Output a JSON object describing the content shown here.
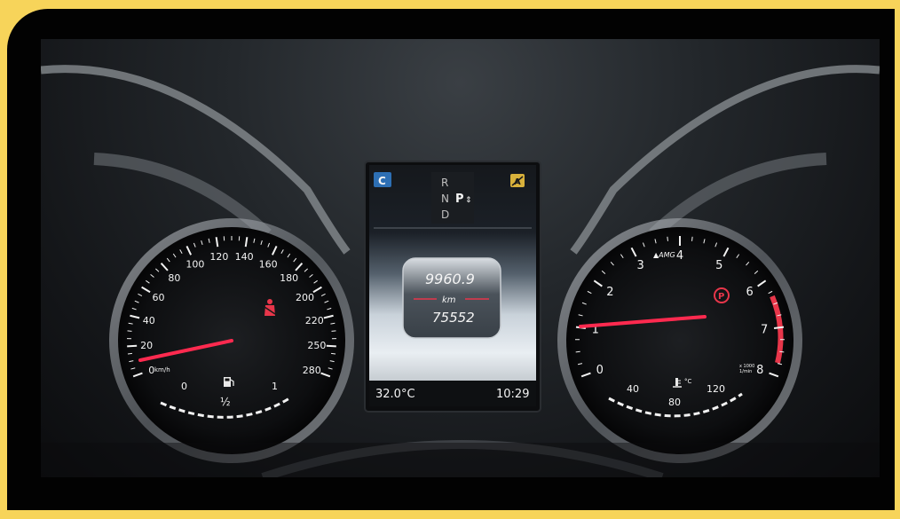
{
  "speedometer": {
    "ticks": [
      "0",
      "20",
      "40",
      "60",
      "80",
      "100",
      "120",
      "140",
      "160",
      "180",
      "200",
      "220",
      "250",
      "280"
    ],
    "unit": "km/h",
    "needle_value_kmh": 0,
    "fuel": {
      "empty_label": "0",
      "half_label": "½",
      "full_label": "1",
      "icon": "fuel-pump-icon"
    }
  },
  "tachometer": {
    "ticks": [
      "0",
      "1",
      "2",
      "3",
      "4",
      "5",
      "6",
      "7",
      "8"
    ],
    "brand": "▲AMG",
    "unit_line1": "x 1000",
    "unit_line2": "1/min",
    "needle_value_rpm_k": 0.9,
    "coolant": {
      "low_label": "40",
      "mid_label": "80",
      "high_label": "120",
      "unit": "°C",
      "icon": "coolant-temp-icon"
    }
  },
  "center_display": {
    "mode_badge": "C",
    "gears": {
      "r": "R",
      "n": "N",
      "d": "D",
      "selected": "P"
    },
    "odometer_trip": "9960.9",
    "odometer_unit": "km",
    "odometer_total": "75552",
    "outside_temp": "32.0°C",
    "clock": "10:29"
  },
  "warnings": {
    "seatbelt": "seatbelt-warning-icon",
    "parking_brake": "parking-brake-icon",
    "auto_stop": "eco-start-stop-icon",
    "colors": {
      "red": "#e8364a",
      "amber": "#d8b13b",
      "blue": "#2d6fb4"
    }
  }
}
